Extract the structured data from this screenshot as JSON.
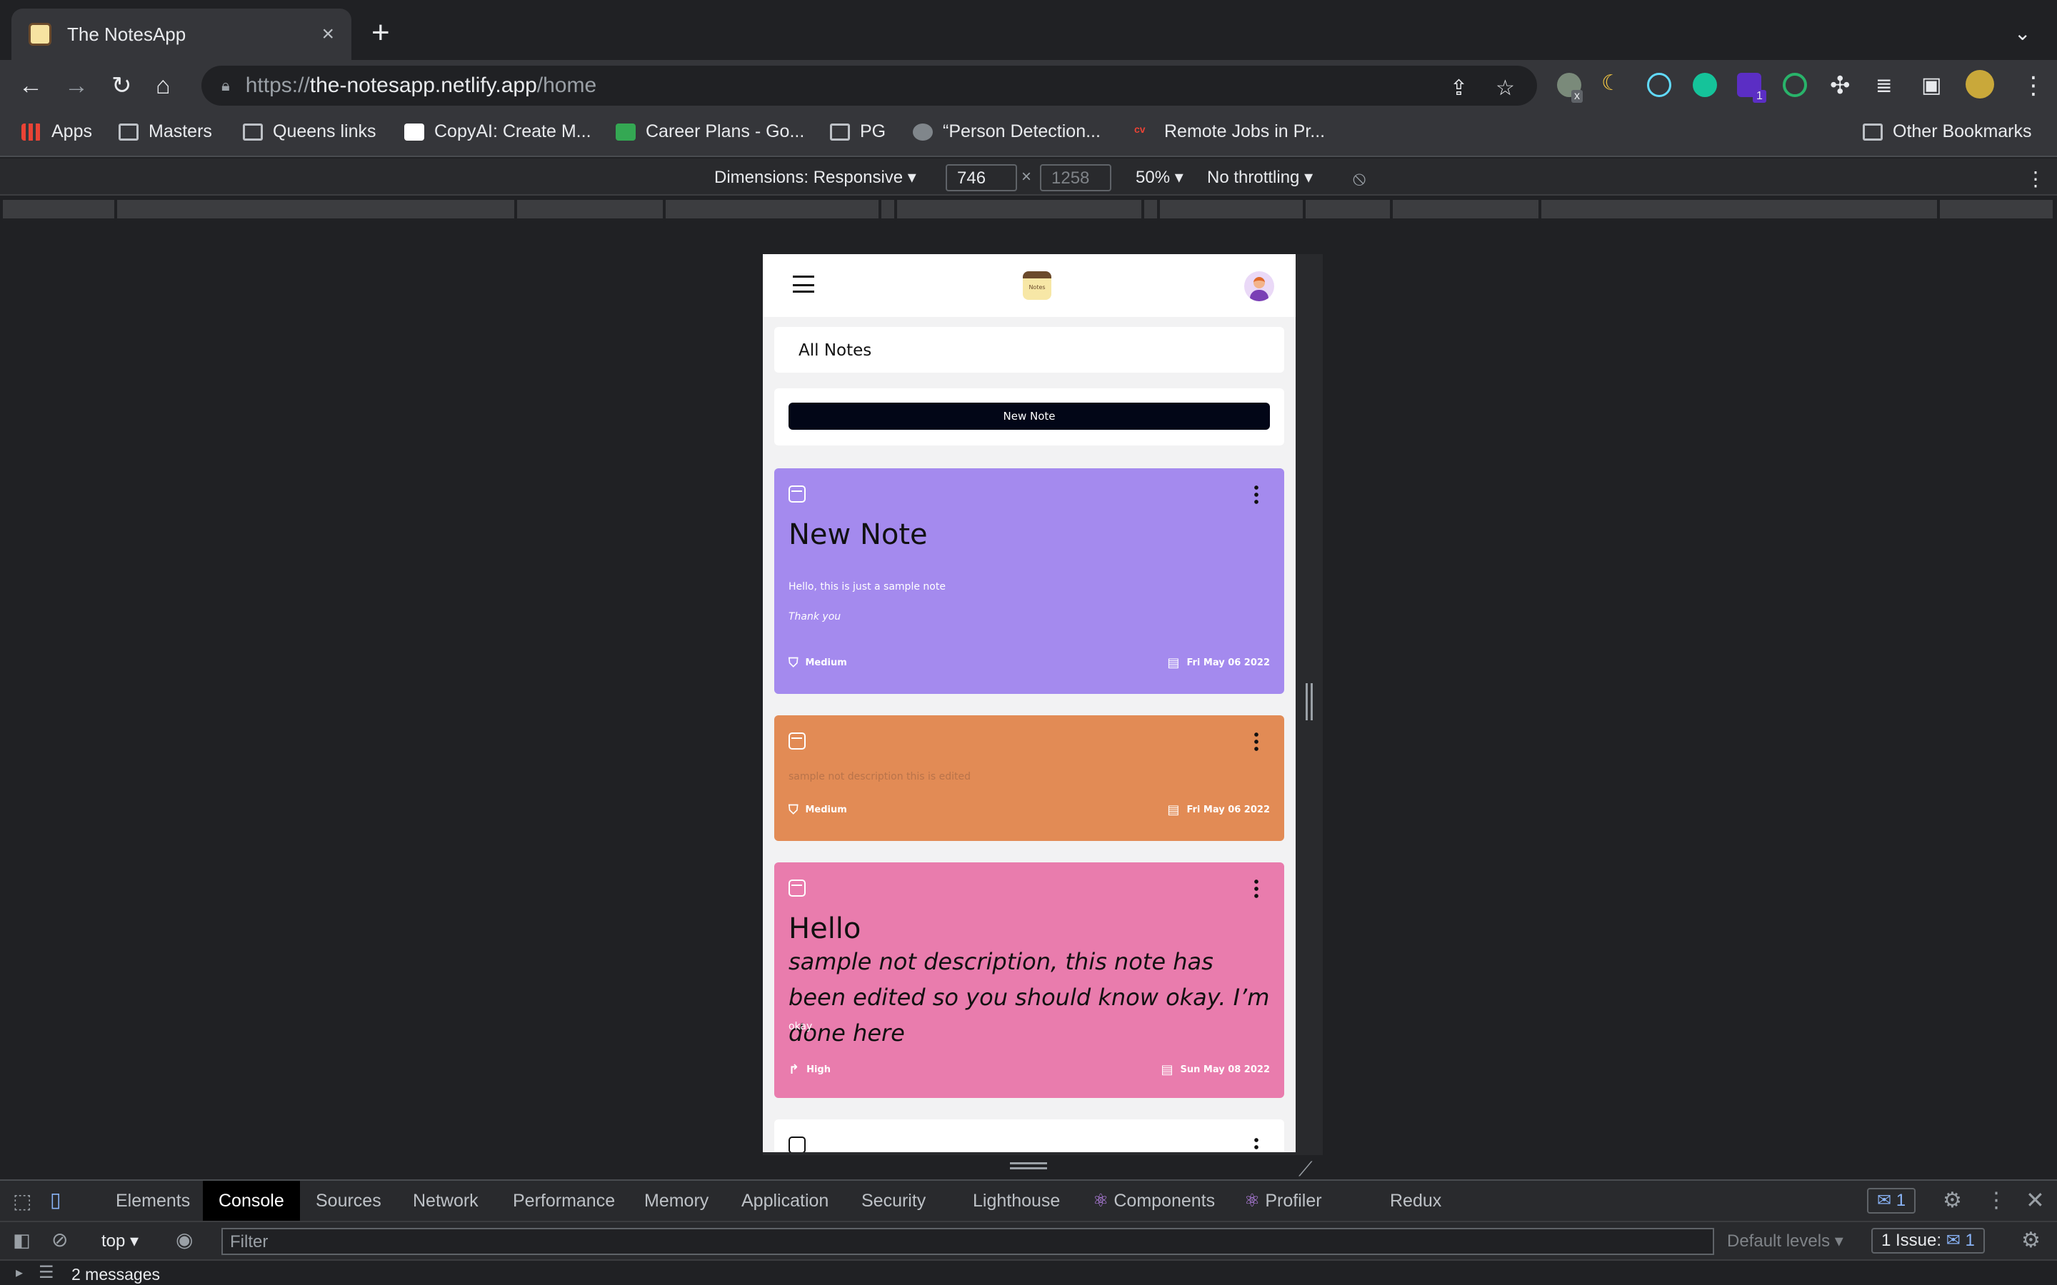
{
  "browser": {
    "tab_title": "The NotesApp",
    "tab_close": "×",
    "new_tab": "+",
    "tab_menu": "⌄",
    "url_scheme": "https://",
    "url_host": "the-notesapp.netlify.app",
    "url_path": "/home",
    "bookmarks": [
      "Apps",
      "Masters",
      "Queens links",
      "CopyAI: Create M...",
      "Career Plans - Go...",
      "PG",
      "“Person Detection...",
      "Remote Jobs in Pr...",
      "Other Bookmarks"
    ],
    "extension_badge": "1",
    "extension_x": "x"
  },
  "device_toolbar": {
    "dimensions_label": "Dimensions: Responsive",
    "width": "746",
    "height_placeholder": "1258",
    "times": "×",
    "zoom": "50%",
    "throttling": "No throttling"
  },
  "app": {
    "logo_text": "Notes",
    "all_notes": "All Notes",
    "new_note_button": "New Note",
    "notes": [
      {
        "title": "New Note",
        "lines": [
          "Hello, this is just a sample note",
          "Thank you"
        ],
        "priority": "Medium",
        "date": "Fri May 06 2022",
        "color": "#a48aee"
      },
      {
        "title": "",
        "lines": [
          "sample not description this is edited"
        ],
        "priority": "Medium",
        "date": "Fri May 06 2022",
        "color": "#e28b55"
      },
      {
        "title": "Hello",
        "lines": [
          "sample not description, this note has been edited so you should know okay. I’m done here",
          "okay"
        ],
        "priority": "High",
        "date": "Sun May 08 2022",
        "color": "#e97cad"
      }
    ]
  },
  "devtools": {
    "tabs": [
      "Elements",
      "Console",
      "Sources",
      "Network",
      "Performance",
      "Memory",
      "Application",
      "Security",
      "Lighthouse",
      "Components",
      "Profiler",
      "Redux"
    ],
    "active_tab": "Console",
    "issues_badge": "1",
    "context": "top",
    "filter_placeholder": "Filter",
    "levels": "Default levels",
    "issues_label": "1 Issue:",
    "issues_count": "1",
    "messages": "2 messages"
  }
}
